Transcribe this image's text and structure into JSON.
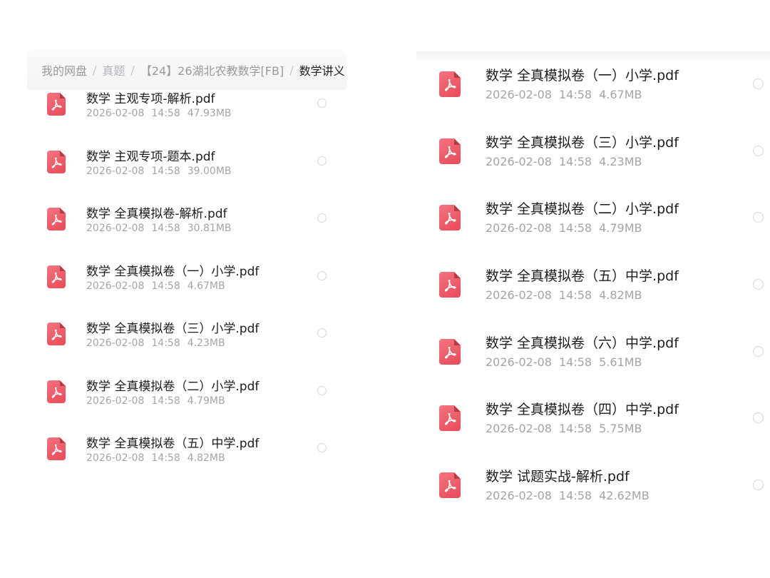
{
  "left_panel": {
    "breadcrumb": {
      "items": [
        "我的网盘",
        "真题",
        "【24】26湖北农教数学[FB]"
      ],
      "current": "数学讲义"
    },
    "files": [
      {
        "name": "数学 主观专项-解析.pdf",
        "date": "2026-02-08",
        "time": "14:58",
        "size": "47.93MB"
      },
      {
        "name": "数学 主观专项-题本.pdf",
        "date": "2026-02-08",
        "time": "14:58",
        "size": "39.00MB"
      },
      {
        "name": "数学 全真模拟卷-解析.pdf",
        "date": "2026-02-08",
        "time": "14:58",
        "size": "30.81MB"
      },
      {
        "name": "数学 全真模拟卷（一）小学.pdf",
        "date": "2026-02-08",
        "time": "14:58",
        "size": "4.67MB"
      },
      {
        "name": "数学 全真模拟卷（三）小学.pdf",
        "date": "2026-02-08",
        "time": "14:58",
        "size": "4.23MB"
      },
      {
        "name": "数学 全真模拟卷（二）小学.pdf",
        "date": "2026-02-08",
        "time": "14:58",
        "size": "4.79MB"
      },
      {
        "name": "数学 全真模拟卷（五）中学.pdf",
        "date": "2026-02-08",
        "time": "14:58",
        "size": "4.82MB"
      }
    ]
  },
  "right_panel": {
    "files": [
      {
        "name": "数学 全真模拟卷（一）小学.pdf",
        "date": "2026-02-08",
        "time": "14:58",
        "size": "4.67MB"
      },
      {
        "name": "数学 全真模拟卷（三）小学.pdf",
        "date": "2026-02-08",
        "time": "14:58",
        "size": "4.23MB"
      },
      {
        "name": "数学 全真模拟卷（二）小学.pdf",
        "date": "2026-02-08",
        "time": "14:58",
        "size": "4.79MB"
      },
      {
        "name": "数学 全真模拟卷（五）中学.pdf",
        "date": "2026-02-08",
        "time": "14:58",
        "size": "4.82MB"
      },
      {
        "name": "数学 全真模拟卷（六）中学.pdf",
        "date": "2026-02-08",
        "time": "14:58",
        "size": "5.61MB"
      },
      {
        "name": "数学 全真模拟卷（四）中学.pdf",
        "date": "2026-02-08",
        "time": "14:58",
        "size": "5.75MB"
      },
      {
        "name": "数学 试题实战-解析.pdf",
        "date": "2026-02-08",
        "time": "14:58",
        "size": "42.62MB"
      }
    ]
  },
  "icons": {
    "file": "pdf-file-icon",
    "select": "radio-circle-icon"
  },
  "colors": {
    "pdf_icon": "#e95565",
    "meta_text": "#a4a4a8",
    "name_text": "#1c1c1c"
  }
}
